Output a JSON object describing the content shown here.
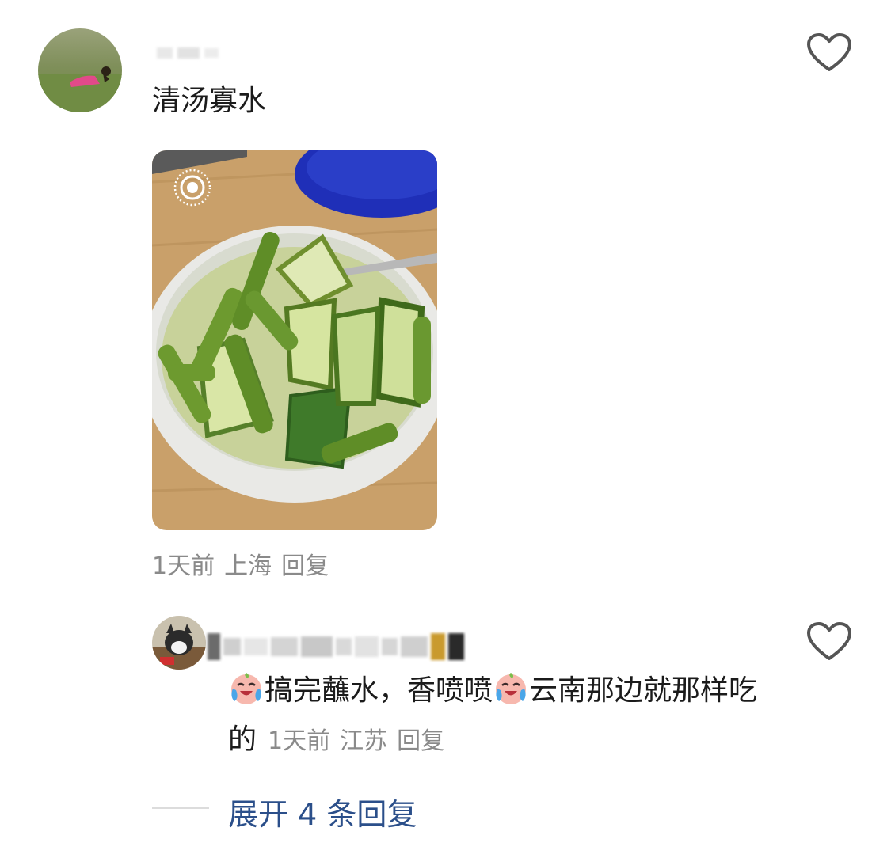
{
  "comment": {
    "text": "清汤寡水",
    "photo_alt_icon": "live-photo-icon",
    "time": "1天前",
    "location": "上海",
    "reply_label": "回复"
  },
  "reply": {
    "text_part1": "搞完蘸水，香喷喷",
    "text_part2": "云南那边就那样吃的",
    "emoji_icon": "crying-laughing-peach-emoji",
    "time": "1天前",
    "location": "江苏",
    "reply_label": "回复"
  },
  "expand": {
    "label": "展开 4 条回复"
  },
  "colors": {
    "text": "#1b1b1b",
    "meta": "#8a8a8a",
    "link": "#2b4f8a"
  }
}
